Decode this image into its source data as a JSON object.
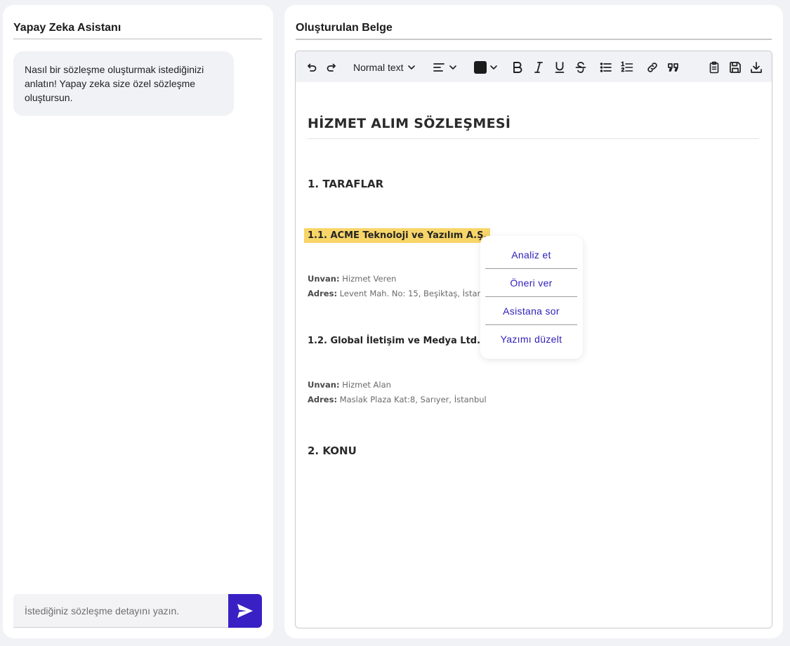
{
  "assistant": {
    "title": "Yapay Zeka Asistanı",
    "welcome_message": "Nasıl bir sözleşme oluşturmak istediğinizi anlatın! Yapay zeka size özel sözleşme oluştursun.",
    "input_placeholder": "İstediğiniz sözleşme detayını yazın.",
    "input_value": "",
    "send_icon": "send-icon"
  },
  "editor_panel": {
    "title": "Oluşturulan Belge"
  },
  "toolbar": {
    "block_type": "Normal text",
    "text_color": "#1b1b1b",
    "icons": [
      "undo-icon",
      "redo-icon",
      "align-left-icon",
      "bold-icon",
      "italic-icon",
      "underline-icon",
      "strikethrough-icon",
      "bullet-list-icon",
      "numbered-list-icon",
      "link-icon",
      "quote-icon",
      "clipboard-icon",
      "save-icon",
      "download-icon"
    ]
  },
  "document": {
    "title": "HİZMET ALIM SÖZLEŞMESİ",
    "section1": "1. TARAFLAR",
    "party1": {
      "heading": "1.1. ACME Teknoloji ve Yazılım A.Ş.",
      "unvan_label": "Unvan:",
      "unvan_value": "Hizmet Veren",
      "adres_label": "Adres:",
      "adres_value": "Levent Mah. No: 15, Beşiktaş, İstan"
    },
    "party2": {
      "heading": "1.2. Global İletişim ve Medya Ltd. Şti.",
      "unvan_label": "Unvan:",
      "unvan_value": "Hizmet Alan",
      "adres_label": "Adres:",
      "adres_value": "Maslak Plaza Kat:8, Sarıyer, İstanbul"
    },
    "section2": "2. KONU"
  },
  "context_menu": {
    "items": [
      "Analiz et",
      "Öneri ver",
      "Asistana sor",
      "Yazımı düzelt"
    ]
  },
  "colors": {
    "accent": "#3920c4",
    "menu_text": "#2d1fb8",
    "highlight": "#f8d568",
    "background": "#f1f2f6"
  }
}
